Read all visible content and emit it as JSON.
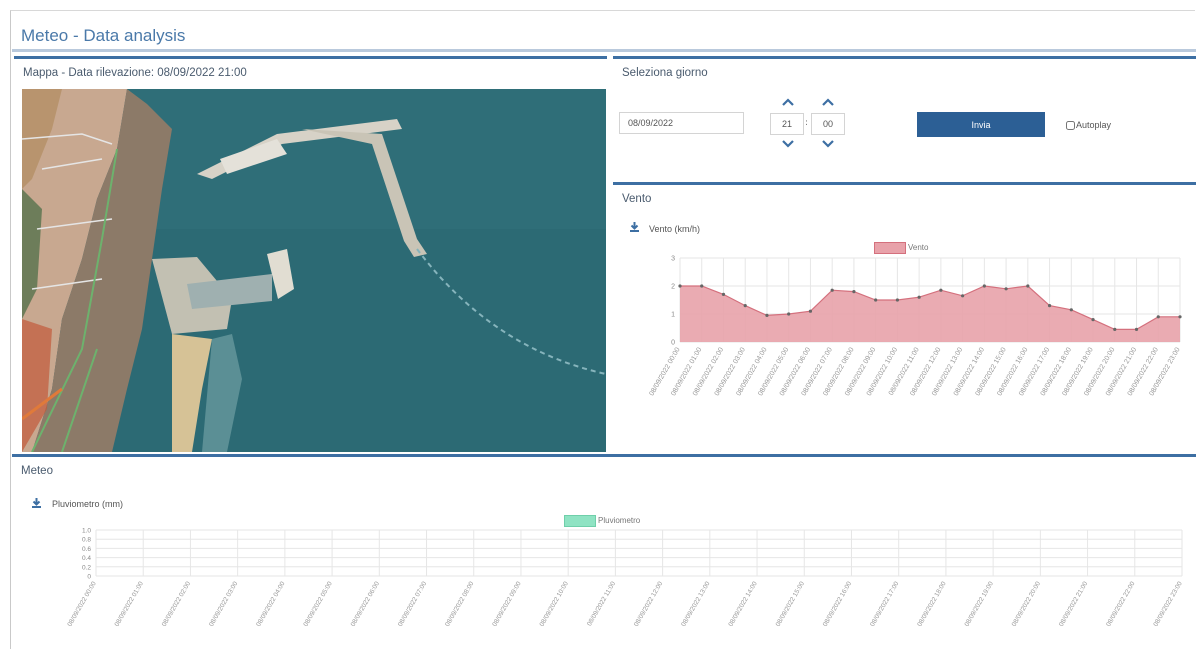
{
  "app": {
    "title": "Meteo - Data analysis"
  },
  "map_panel": {
    "title": "Mappa - Data rilevazione: 08/09/2022 21:00"
  },
  "day_panel": {
    "title": "Seleziona giorno",
    "date_value": "08/09/2022",
    "hour_value": "21",
    "minute_value": "00",
    "separator": ":",
    "submit_label": "Invia",
    "autoplay_label": "Autoplay"
  },
  "wind_panel": {
    "title": "Vento",
    "chart_label": "Vento (km/h)",
    "legend": "Vento"
  },
  "meteo_panel": {
    "title": "Meteo",
    "chart_label": "Pluviometro (mm)",
    "legend": "Pluviometro"
  },
  "colors": {
    "accent": "#3d6fa3",
    "wind_fill": "#e8a2aa",
    "wind_line": "#d4707d",
    "rain_fill": "#8fe3c3"
  },
  "chart_data": [
    {
      "type": "area",
      "series": [
        {
          "name": "Vento",
          "values": [
            2.0,
            2.0,
            1.7,
            1.3,
            0.95,
            1.0,
            1.1,
            1.85,
            1.8,
            1.5,
            1.5,
            1.6,
            1.85,
            1.65,
            2.0,
            1.9,
            2.0,
            1.3,
            1.15,
            0.8,
            0.45,
            0.45,
            0.9,
            0.9
          ]
        }
      ],
      "x": [
        "08/09/2022 00:00",
        "08/09/2022 01:00",
        "08/09/2022 02:00",
        "08/09/2022 03:00",
        "08/09/2022 04:00",
        "08/09/2022 05:00",
        "08/09/2022 06:00",
        "08/09/2022 07:00",
        "08/09/2022 08:00",
        "08/09/2022 09:00",
        "08/09/2022 10:00",
        "08/09/2022 11:00",
        "08/09/2022 12:00",
        "08/09/2022 13:00",
        "08/09/2022 14:00",
        "08/09/2022 15:00",
        "08/09/2022 16:00",
        "08/09/2022 17:00",
        "08/09/2022 18:00",
        "08/09/2022 19:00",
        "08/09/2022 20:00",
        "08/09/2022 21:00",
        "08/09/2022 22:00",
        "08/09/2022 23:00"
      ],
      "ylim": [
        0,
        3
      ],
      "yticks": [
        "0",
        "1",
        "2",
        "3"
      ],
      "grid": true,
      "legend_position": "top-center"
    },
    {
      "type": "bar",
      "series": [
        {
          "name": "Pluviometro",
          "values": [
            0,
            0,
            0,
            0,
            0,
            0,
            0,
            0,
            0,
            0,
            0,
            0,
            0,
            0,
            0,
            0,
            0,
            0,
            0,
            0,
            0,
            0,
            0,
            0
          ]
        }
      ],
      "x": [
        "08/09/2022 00:00",
        "08/09/2022 01:00",
        "08/09/2022 02:00",
        "08/09/2022 03:00",
        "08/09/2022 04:00",
        "08/09/2022 05:00",
        "08/09/2022 06:00",
        "08/09/2022 07:00",
        "08/09/2022 08:00",
        "08/09/2022 09:00",
        "08/09/2022 10:00",
        "08/09/2022 11:00",
        "08/09/2022 12:00",
        "08/09/2022 13:00",
        "08/09/2022 14:00",
        "08/09/2022 15:00",
        "08/09/2022 16:00",
        "08/09/2022 17:00",
        "08/09/2022 18:00",
        "08/09/2022 19:00",
        "08/09/2022 20:00",
        "08/09/2022 21:00",
        "08/09/2022 22:00",
        "08/09/2022 23:00"
      ],
      "ylim": [
        0,
        1
      ],
      "yticks": [
        "0",
        "0.2",
        "0.4",
        "0.6",
        "0.8",
        "1.0"
      ],
      "grid": true,
      "legend_position": "top-center"
    }
  ]
}
